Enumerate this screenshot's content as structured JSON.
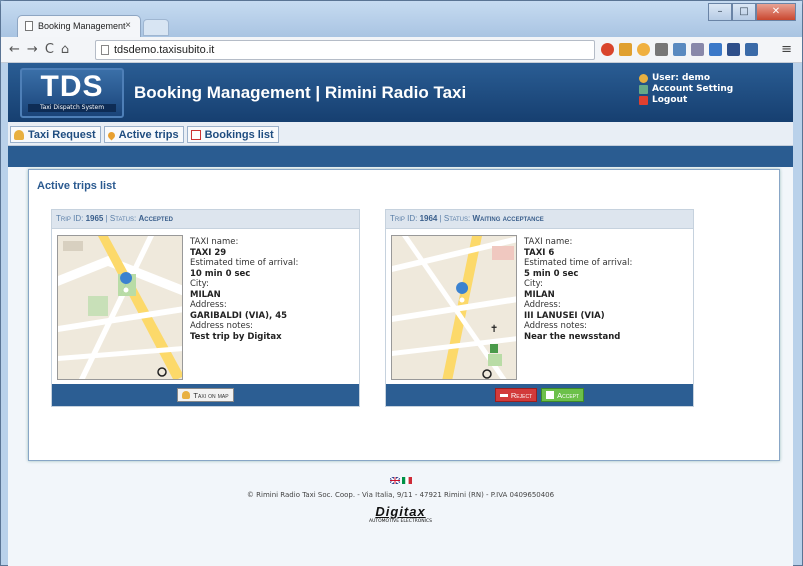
{
  "browser": {
    "tab_title": "Booking Management",
    "tab_close": "×",
    "url": "tdsdemo.taxisubito.it"
  },
  "header": {
    "logo_text": "TDS",
    "logo_subtitle": "Taxi Dispatch System",
    "title": "Booking Management | Rimini Radio Taxi",
    "user_label": "User: demo",
    "account_setting": "Account Setting",
    "logout": "Logout"
  },
  "nav": {
    "taxi_request": "Taxi Request",
    "active_trips": "Active trips",
    "bookings_list": "Bookings list"
  },
  "panel": {
    "title": "Active trips list"
  },
  "trips": [
    {
      "id_label": "Trip ID:",
      "id": "1965",
      "status_label": "Status:",
      "status": "Accepted",
      "taxi_name_label": "TAXI name:",
      "taxi_name": "TAXI 29",
      "eta_label": "Estimated time of arrival:",
      "eta": "10 min 0 sec",
      "city_label": "City:",
      "city": "MILAN",
      "address_label": "Address:",
      "address": "GARIBALDI (VIA), 45",
      "notes_label": "Address notes:",
      "notes": "Test trip by Digitax",
      "btn_map": "Taxi on map"
    },
    {
      "id_label": "Trip ID:",
      "id": "1964",
      "status_label": "Status:",
      "status": "Waiting acceptance",
      "taxi_name_label": "TAXI name:",
      "taxi_name": "TAXI 6",
      "eta_label": "Estimated time of arrival:",
      "eta": "5 min 0 sec",
      "city_label": "City:",
      "city": "MILAN",
      "address_label": "Address:",
      "address": "III LANUSEI (VIA)",
      "notes_label": "Address notes:",
      "notes": "Near the newsstand",
      "btn_reject": "Reject",
      "btn_accept": "Accept"
    }
  ],
  "footer": {
    "copyright": "© Rimini Radio Taxi Soc. Coop. - Via Italia, 9/11 - 47921 Rimini (RN) - P.IVA 0409650406",
    "brand": "Digitax",
    "brand_sub": "AUTOMOTIVE ELECTRONICS"
  },
  "colors": {
    "header_blue": "#1f4f86",
    "accent_blue": "#2c5e93",
    "reject": "#d23a3a",
    "accept": "#6cc04a"
  }
}
